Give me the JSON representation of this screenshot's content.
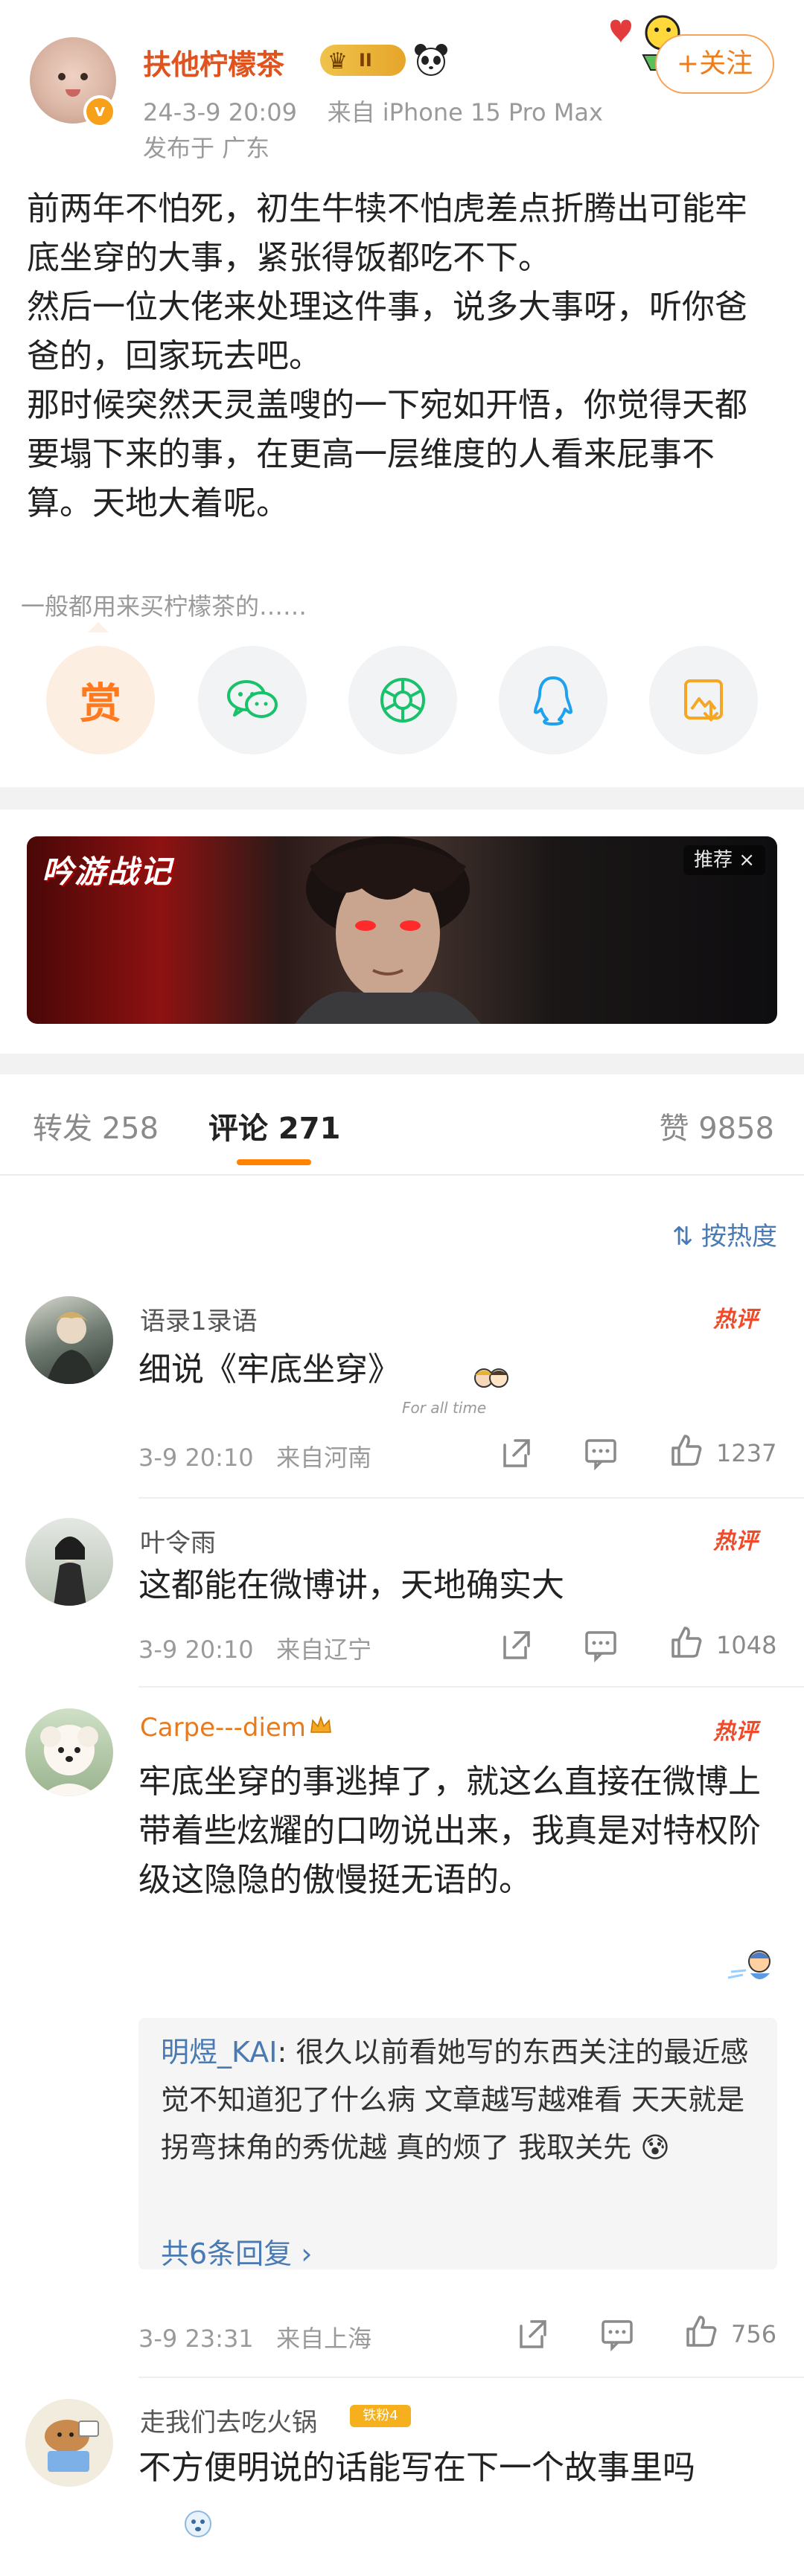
{
  "post": {
    "author": "扶他柠檬茶",
    "vip_label": "II",
    "verified_mark": "v",
    "time": "24-3-9 20:09",
    "source": "来自 iPhone 15 Pro Max",
    "location": "发布于 广东",
    "follow_label": "+关注",
    "body": "前两年不怕死，初生牛犊不怕虎差点折腾出可能牢底坐穿的大事，紧张得饭都吃不下。\n然后一位大佬来处理这件事，说多大事呀，听你爸爸的，回家玩去吧。\n那时候突然天灵盖嗖的一下宛如开悟，你觉得天都要塌下来的事，在更高一层维度的人看来屁事不算。天地大着呢。"
  },
  "reward": {
    "hint": "一般都用来买柠檬茶的……",
    "reward_label": "赏"
  },
  "share_icons": [
    "wechat-icon",
    "moments-icon",
    "qq-icon",
    "save-image-icon"
  ],
  "ad": {
    "logo": "吟游战记",
    "tag": "推荐 ×"
  },
  "tabs": {
    "repost": "转发 258",
    "comment": "评论 271",
    "like": "赞 9858"
  },
  "sort_label": "按热度",
  "comments": [
    {
      "name": "语录1录语",
      "hot": "热评",
      "text": "细说《牢底坐穿》",
      "sticker": "For all time",
      "time": "3-9 20:10",
      "location": "来自河南",
      "likes": "1237"
    },
    {
      "name": "叶令雨",
      "hot": "热评",
      "text": "这都能在微博讲，天地确实大",
      "time": "3-9 20:10",
      "location": "来自辽宁",
      "likes": "1048"
    },
    {
      "name": "Carpe---diem",
      "hot": "热评",
      "text": "牢底坐穿的事逃掉了，就这么直接在微博上带着些炫耀的口吻说出来，我真是对特权阶级这隐隐的傲慢挺无语的。",
      "reply_name": "明煜_KAI",
      "reply_text": "很久以前看她写的东西关注的最近感觉不知道犯了什么病 文章越写越难看 天天就是拐弯抹角的秀优越 真的烦了 我取关先",
      "reply_more": "共6条回复 ›",
      "time": "3-9 23:31",
      "location": "来自上海",
      "likes": "756"
    },
    {
      "name": "走我们去吃火锅",
      "badge": "铁粉4",
      "text": "不方便明说的话能写在下一个故事里吗"
    }
  ],
  "colors": {
    "accent": "#ff8200",
    "author": "#e0531f",
    "link": "#4a7ab3",
    "hot": "#ef4b2a"
  }
}
